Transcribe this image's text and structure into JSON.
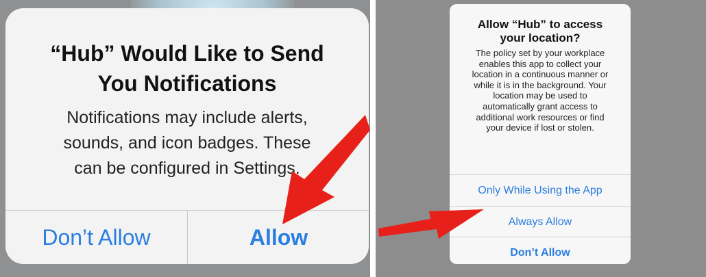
{
  "left_alert": {
    "title_line1": "“Hub” Would Like to Send",
    "title_line2": "You Notifications",
    "message_line1": "Notifications may include alerts,",
    "message_line2": "sounds, and icon badges. These",
    "message_line3": "can be configured in Settings.",
    "buttons": {
      "dont_allow": "Don’t Allow",
      "allow": "Allow"
    }
  },
  "right_alert": {
    "title_line1": "Allow “Hub” to access",
    "title_line2": "your location?",
    "message_lines": [
      "The policy set by your workplace",
      "enables this app to collect your",
      "location in a continuous manner or",
      "while it is in the background. Your",
      "location may be used to",
      "automatically grant access to",
      "additional work resources or find",
      "your device if lost or stolen."
    ],
    "options": {
      "only_while_using": "Only While Using the App",
      "always_allow": "Always Allow",
      "dont_allow": "Don’t Allow"
    }
  },
  "colors": {
    "ios_blue": "#2a7ee0",
    "arrow_red": "#e8201a",
    "backdrop_gray": "#8f9091"
  }
}
